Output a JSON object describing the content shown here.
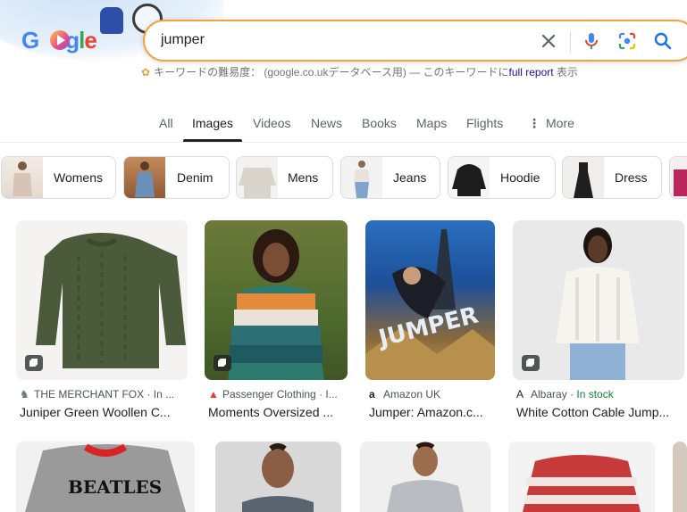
{
  "search": {
    "query": "jumper",
    "clear_icon": "close-icon",
    "voice_icon": "microphone-icon",
    "lens_icon": "camera-lens-icon",
    "search_icon": "search-icon"
  },
  "logo": {
    "text": "Google"
  },
  "keyword_info": {
    "prefix": "キーワードの難易度：",
    "db": "(google.co.ukデータベース用) — このキーワードに",
    "link": "full report",
    "suffix": "表示"
  },
  "tabs": [
    {
      "label": "All"
    },
    {
      "label": "Images"
    },
    {
      "label": "Videos"
    },
    {
      "label": "News"
    },
    {
      "label": "Books"
    },
    {
      "label": "Maps"
    },
    {
      "label": "Flights"
    },
    {
      "label": "More"
    }
  ],
  "chips": [
    {
      "label": "Womens"
    },
    {
      "label": "Denim"
    },
    {
      "label": "Mens"
    },
    {
      "label": "Jeans"
    },
    {
      "label": "Hoodie"
    },
    {
      "label": "Dress"
    }
  ],
  "results": [
    {
      "source": "THE MERCHANT FOX · In ...",
      "title": "Juniper Green Woollen C..."
    },
    {
      "source": "Passenger Clothing · I...",
      "title": "Moments Oversized ..."
    },
    {
      "source": "Amazon UK",
      "title": "Jumper: Amazon.c..."
    },
    {
      "source": "Albaray · ",
      "stock": "In stock",
      "title": "White Cotton Cable Jump..."
    }
  ],
  "second_row_texts": {
    "beatles": "BEATLES"
  },
  "colors": {
    "accent_border": "#f0a340",
    "link": "#1a0dab",
    "stock": "#188038"
  }
}
